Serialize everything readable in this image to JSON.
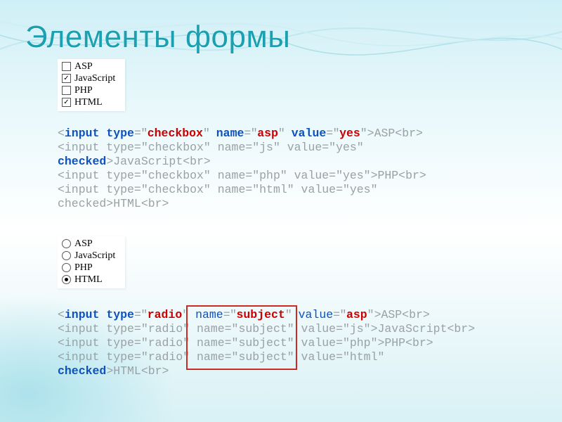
{
  "title": "Элементы формы",
  "checkbox_panel": {
    "items": [
      {
        "label": "ASP",
        "checked": false
      },
      {
        "label": "JavaScript",
        "checked": true
      },
      {
        "label": "PHP",
        "checked": false
      },
      {
        "label": "HTML",
        "checked": true
      }
    ]
  },
  "radio_panel": {
    "items": [
      {
        "label": "ASP",
        "checked": false
      },
      {
        "label": "JavaScript",
        "checked": false
      },
      {
        "label": "PHP",
        "checked": false
      },
      {
        "label": "HTML",
        "checked": true
      }
    ]
  },
  "code1": {
    "l1a": "<",
    "l1b": "input ",
    "l1c": "type",
    "l1d": "=\"",
    "l1e": "checkbox",
    "l1f": "\" ",
    "l1g": "name",
    "l1h": "=\"",
    "l1i": "asp",
    "l1j": "\" ",
    "l1k": "value",
    "l1l": "=\"",
    "l1m": "yes",
    "l1n": "\">ASP<br>",
    "l2": "<input type=\"checkbox\" name=\"js\" value=\"yes\"",
    "l3a": "checked",
    "l3b": ">JavaScript<br>",
    "l4": "<input type=\"checkbox\" name=\"php\" value=\"yes\">PHP<br>",
    "l5": "<input type=\"checkbox\" name=\"html\" value=\"yes\"",
    "l6": "checked>HTML<br>"
  },
  "code2": {
    "l1a": "<",
    "l1b": "input ",
    "l1c": "type",
    "l1d": "=\"",
    "l1e": "radio",
    "l1f": "\" ",
    "l1g": "name",
    "l1h": "=\"",
    "l1i": "subject",
    "l1j": "\" ",
    "l1k": "value",
    "l1l": "=\"",
    "l1m": "asp",
    "l1n": "\">ASP<br>",
    "l2": "<input type=\"radio\" name=\"subject\" value=\"js\">JavaScript<br>",
    "l3": "<input type=\"radio\" name=\"subject\" value=\"php\">PHP<br>",
    "l4": "<input type=\"radio\" name=\"subject\" value=\"html\"",
    "l5a": "checked",
    "l5b": ">HTML<br>"
  }
}
